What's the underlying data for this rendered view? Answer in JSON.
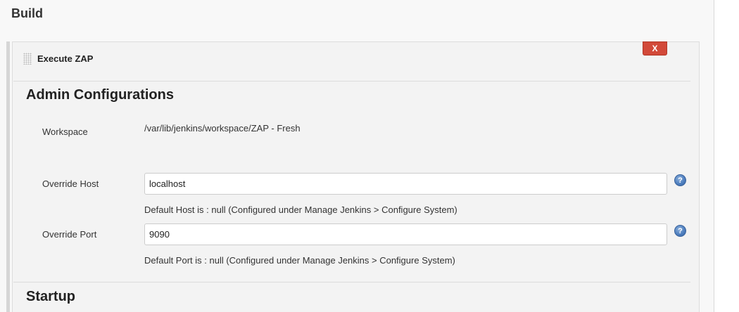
{
  "build": {
    "title": "Build"
  },
  "step": {
    "title": "Execute ZAP",
    "delete_label": "X"
  },
  "admin": {
    "section_title": "Admin Configurations",
    "workspace_label": "Workspace",
    "workspace_value": "/var/lib/jenkins/workspace/ZAP - Fresh",
    "host_label": "Override Host",
    "host_value": "localhost",
    "host_hint": "Default Host is : null (Configured under Manage Jenkins > Configure System)",
    "port_label": "Override Port",
    "port_value": "9090",
    "port_hint": "Default Port is : null (Configured under Manage Jenkins > Configure System)",
    "help_glyph": "?"
  },
  "startup": {
    "section_title": "Startup"
  },
  "colors": {
    "delete_button": "#d24939",
    "help_icon": "#4f7fbf",
    "panel_background": "#f3f3f3"
  },
  "icons": [
    "drag-handle-icon",
    "help-icon"
  ]
}
